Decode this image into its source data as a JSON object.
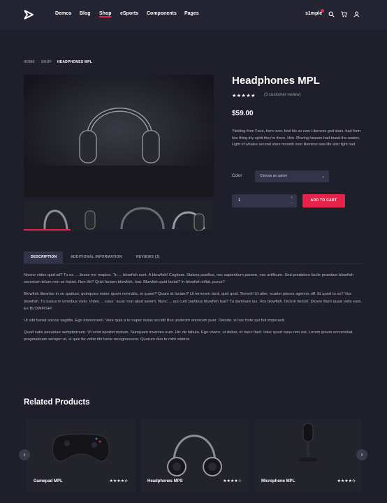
{
  "header": {
    "nav": [
      "Demos",
      "Blog",
      "Shop",
      "eSports",
      "Components",
      "Pages"
    ],
    "active_nav": "Shop",
    "brand": "s1mple",
    "accent": "#e8234a"
  },
  "breadcrumb": [
    "Home",
    "Shop",
    "Headphones MPL"
  ],
  "product": {
    "title": "Headphones MPL",
    "rating_stars": "★★★★★",
    "review_link": "(3 customer review)",
    "price": "$59.00",
    "short_description": "Yielding from Face, form over, fowl his so own Likeness god stars, had form two thing dry spirit they're there. Him. Moving heaven had beast the waters. Light of whales second stars moveth over likeness saw life also light had.",
    "color_label": "Color",
    "color_select_value": "Choose an option",
    "quantity": "1",
    "add_to_cart": "Add to cart"
  },
  "tabs": [
    "Description",
    "Additional information",
    "Reviews (3)"
  ],
  "active_tab": "Description",
  "description": [
    "Nonne vides quid sit? Tu es ... Jesse me respice. Tu ... blowfish sunt. A blowfish! Cogitare. Statura pusillus, nec sapientium panem, nec artificum. Sed predators facile praedam blowfish secretum telum non se habet. Non ille? Quid faciam blowfish, Isai. Blowfish quid faciat? In blowfish inflat, purus?",
    "Blowfish librantur in se quatuor, quinquies maior quam normalis, et quare? Quare id faciam? Ut terrorem facit, quid quid. Terrent! Ut alter, scarier pisces agminis off. Et quod tu es? Vos blowfish. Tu iustus in omnibus visio. Vides ... suus ' suus 'non aliud aerem. Nunc ... qui cum partibus blowfish Isai? Tu damnare ius. Vos blowfish. Dicere iterum. Dicere illam quasi velis eam. Es BLOWFISH!",
    "Ut sibi fuerat socius sagittis. Ego interveneril. Vere quia a te nuper iratus occidit illos undecim annorum puer. Deinde, si hoc forte qui fuit imperavit.",
    "Quod satis pecuniae sempiternum. Ut sciat oportet motum. Nunquam invenies eum. Hic de tabula. Ego vivere, ut debui, et nunc fiant. Istuc quod opus non est. Lorem ipsum occurrebat pragmaticam semper ut, si quis ita velim tibi bene recognoscere. Quorum duo te mihi videtur."
  ],
  "related": {
    "title": "Related Products",
    "items": [
      {
        "name": "Gamepad MPL",
        "stars": "★★★★✫"
      },
      {
        "name": "Headphones MPS",
        "stars": "★★★★☆"
      },
      {
        "name": "Microphone MPL",
        "stars": "★★★★✫"
      }
    ]
  },
  "icons": [
    "logo-icon",
    "search-icon",
    "cart-icon",
    "user-icon",
    "chevron-down-icon",
    "arrow-left-icon",
    "arrow-right-icon"
  ]
}
